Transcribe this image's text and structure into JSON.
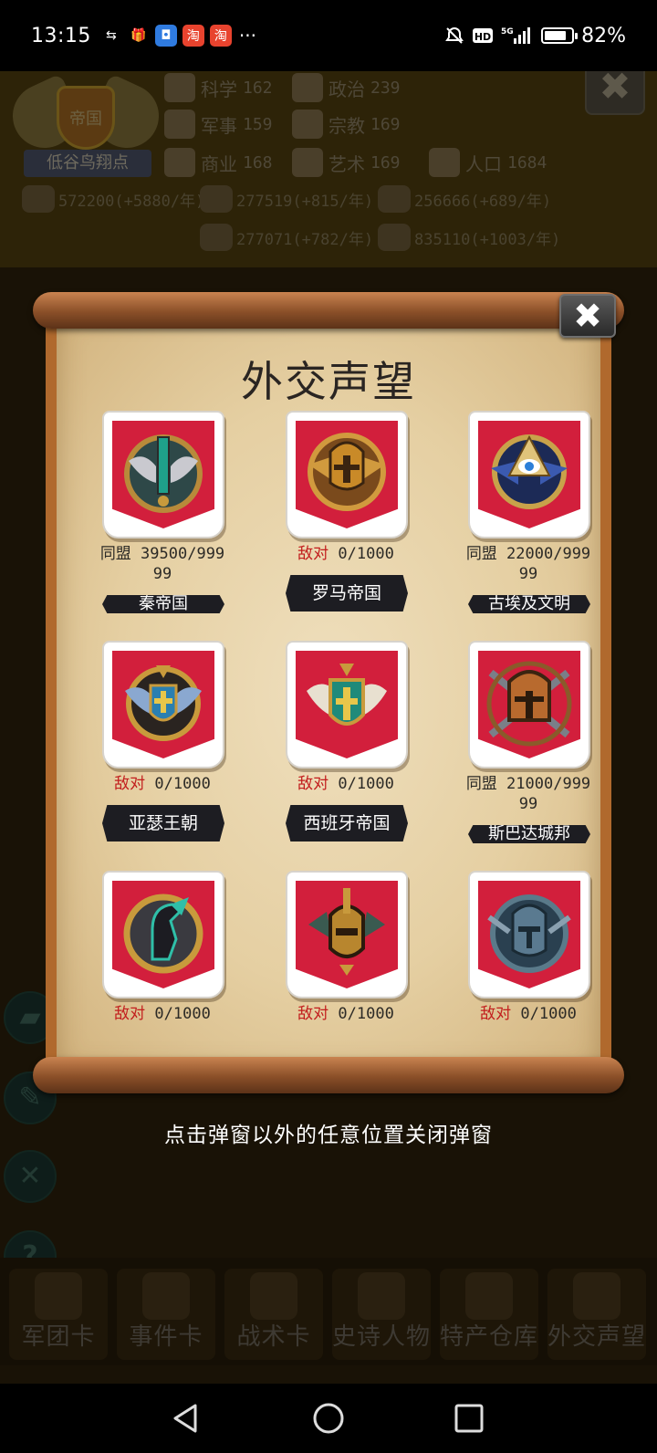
{
  "status_bar": {
    "time": "13:15",
    "apps": [
      {
        "icon": "sync-app-icon",
        "glyph": "⇆",
        "color": "#000000"
      },
      {
        "icon": "gift-app-icon",
        "glyph": "🎁",
        "color": "#000000"
      },
      {
        "icon": "blue-app-icon",
        "glyph": "◘",
        "color": "#2f7be0"
      },
      {
        "icon": "taobao-app-icon",
        "glyph": "淘",
        "color": "#e8432e"
      },
      {
        "icon": "taobao-app-icon",
        "glyph": "淘",
        "color": "#e8432e"
      }
    ],
    "more": "···",
    "battery_percent": "82%",
    "battery_level": 0.82
  },
  "background": {
    "empire_emblem_label": "帝国",
    "empire_name": "低谷鸟翔点",
    "stats": [
      {
        "icon": "science-icon",
        "name": "科学",
        "value": "162"
      },
      {
        "icon": "politics-icon",
        "name": "政治",
        "value": "239"
      },
      {
        "icon": "military-icon",
        "name": "军事",
        "value": "159"
      },
      {
        "icon": "religion-icon",
        "name": "宗教",
        "value": "169"
      },
      {
        "icon": "commerce-icon",
        "name": "商业",
        "value": "168"
      },
      {
        "icon": "art-icon",
        "name": "艺术",
        "value": "169"
      },
      {
        "icon": "population-icon",
        "name": "人口",
        "value": "1684"
      }
    ],
    "resources": [
      {
        "icon": "gold-icon",
        "text": "572200(+5880/年)"
      },
      {
        "icon": "wood-icon",
        "text": "277519(+815/年)"
      },
      {
        "icon": "iron-icon",
        "text": "256666(+689/年)"
      },
      {
        "icon": "stone-icon",
        "text": "277071(+782/年)"
      },
      {
        "icon": "food-icon",
        "text": "835110(+1003/年)"
      }
    ],
    "close_label": "✖",
    "side_buttons": [
      {
        "name": "chat-icon",
        "glyph": "▰"
      },
      {
        "name": "tool-icon",
        "glyph": "✎"
      },
      {
        "name": "mute-icon",
        "glyph": "✕"
      },
      {
        "name": "help-icon",
        "glyph": "?"
      }
    ],
    "bottom_tabs": [
      {
        "name": "legion-cards",
        "label": "军团卡"
      },
      {
        "name": "event-cards",
        "label": "事件卡"
      },
      {
        "name": "tactic-cards",
        "label": "战术卡"
      },
      {
        "name": "epic-figures",
        "label": "史诗人物"
      },
      {
        "name": "specialty-warehouse",
        "label": "特产仓库"
      },
      {
        "name": "diplomatic-reputation",
        "label": "外交声望"
      }
    ]
  },
  "dialog": {
    "title": "外交声望",
    "close_label": "✖",
    "nations": [
      {
        "name": "秦帝国",
        "state": "同盟",
        "value": "39500/99999",
        "line1": "同盟 39500/999",
        "line2": "99",
        "type": "ally",
        "crest": "sword-crest-icon"
      },
      {
        "name": "罗马帝国",
        "state": "敌对",
        "value": "0/1000",
        "line1": "0/1000",
        "line2": "",
        "type": "hostile",
        "crest": "roman-helmet-crest-icon"
      },
      {
        "name": "古埃及文明",
        "state": "同盟",
        "value": "22000/99999",
        "line1": "同盟 22000/999",
        "line2": "99",
        "type": "ally",
        "crest": "eye-pyramid-crest-icon"
      },
      {
        "name": "亚瑟王朝",
        "state": "敌对",
        "value": "0/1000",
        "line1": "0/1000",
        "line2": "",
        "type": "hostile",
        "crest": "winged-shield-crest-icon"
      },
      {
        "name": "西班牙帝国",
        "state": "敌对",
        "value": "0/1000",
        "line1": "0/1000",
        "line2": "",
        "type": "hostile",
        "crest": "cross-shield-crest-icon"
      },
      {
        "name": "斯巴达城邦",
        "state": "同盟",
        "value": "21000/99999",
        "line1": "同盟 21000/999",
        "line2": "99",
        "type": "ally",
        "crest": "spartan-helmet-crest-icon"
      },
      {
        "name": "",
        "state": "敌对",
        "value": "0/1000",
        "line1": "0/1000",
        "line2": "",
        "type": "hostile",
        "crest": "horse-crest-icon"
      },
      {
        "name": "",
        "state": "敌对",
        "value": "0/1000",
        "line1": "0/1000",
        "line2": "",
        "type": "hostile",
        "crest": "warrior-mask-crest-icon"
      },
      {
        "name": "",
        "state": "敌对",
        "value": "0/1000",
        "line1": "0/1000",
        "line2": "",
        "type": "hostile",
        "crest": "knight-helmet-crest-icon"
      }
    ]
  },
  "hint": "点击弹窗以外的任意位置关闭弹窗",
  "nav": {
    "back": "back-icon",
    "home": "home-icon",
    "recents": "recents-icon"
  }
}
